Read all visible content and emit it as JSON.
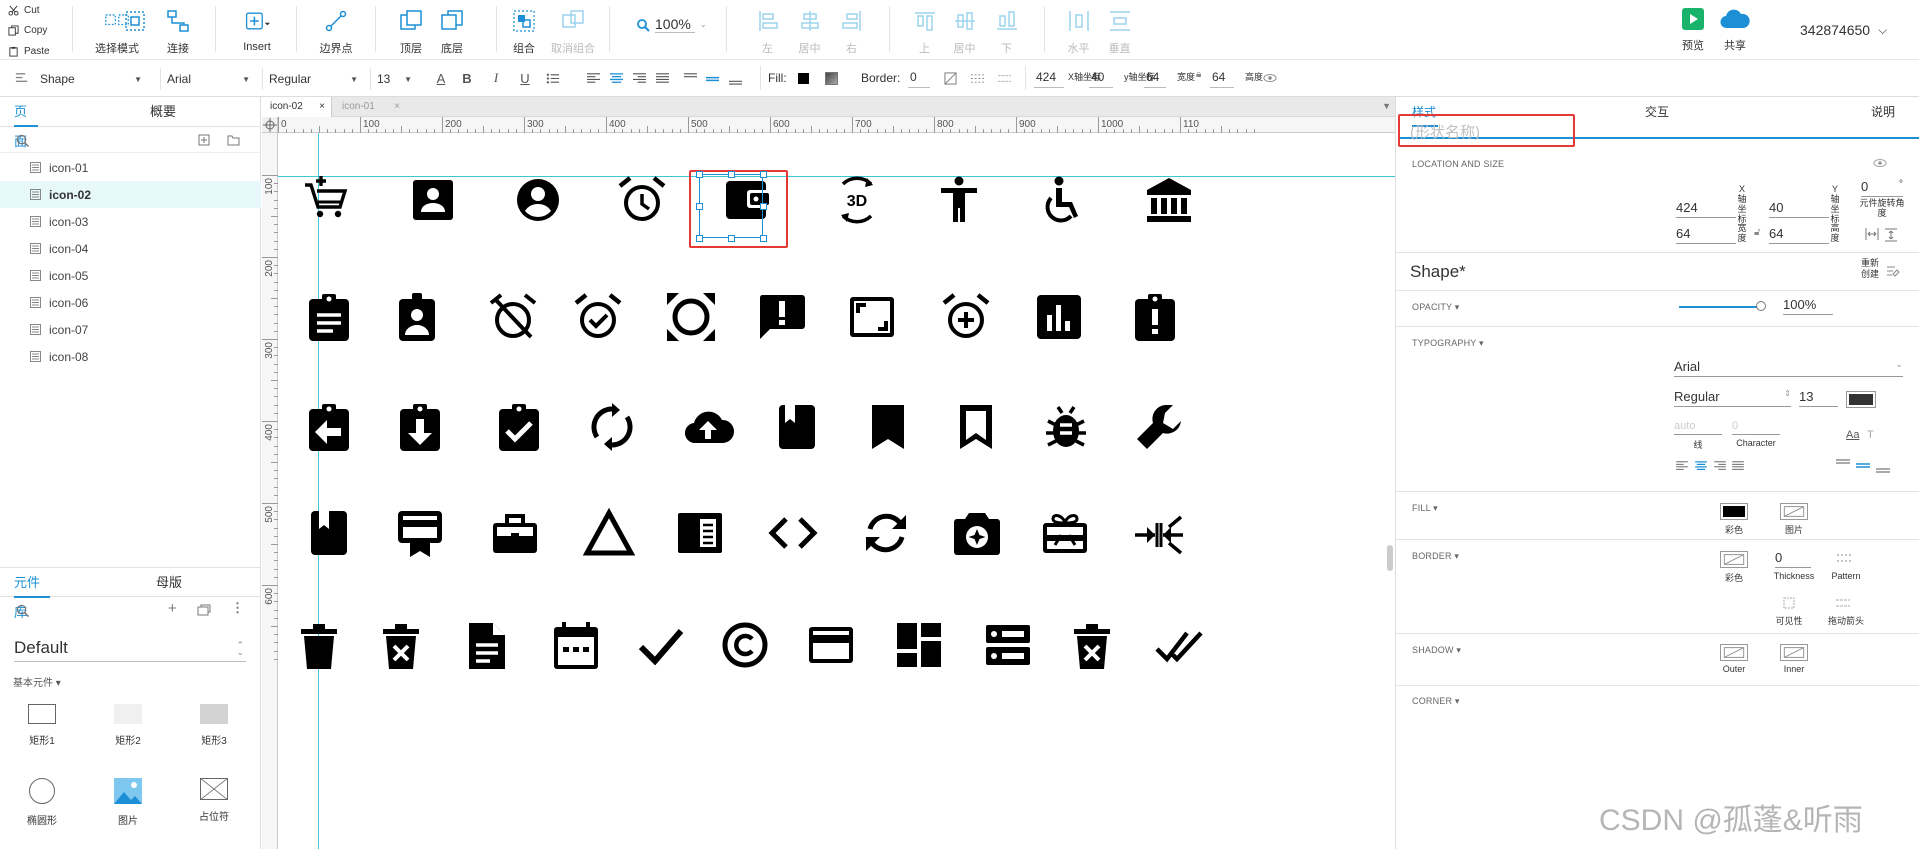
{
  "clipboard": {
    "cut": "Cut",
    "copy": "Copy",
    "paste": "Paste"
  },
  "toolbar": {
    "select_mode": "选择模式",
    "connect": "连接",
    "insert": "Insert",
    "endpoint": "边界点",
    "top_layer": "顶层",
    "bottom_layer": "底层",
    "group": "组合",
    "ungroup": "取消组合",
    "zoom": "100%",
    "align_left": "左",
    "align_center": "居中",
    "align_right": "右",
    "align_top": "上",
    "align_middle": "居中",
    "align_bottom": "下",
    "distribute_h": "水平",
    "distribute_v": "垂直",
    "preview": "预览",
    "share": "共享",
    "user": "342874650"
  },
  "format_bar": {
    "shape_type": "Shape",
    "font": "Arial",
    "weight": "Regular",
    "size": "13",
    "fill_label": "Fill:",
    "border_label": "Border:",
    "border_value": "0",
    "x": "424",
    "x_label": "X轴坐标",
    "y": "40",
    "y_label": "y轴坐标",
    "w": "64",
    "w_label": "宽度",
    "h": "64",
    "h_label": "高度"
  },
  "left_panel": {
    "tabs": [
      "页面",
      "概要"
    ],
    "pages": [
      "icon-01",
      "icon-02",
      "icon-03",
      "icon-04",
      "icon-05",
      "icon-06",
      "icon-07",
      "icon-08"
    ],
    "active_page": "icon-02",
    "lib_tabs": [
      "元件库",
      "母版"
    ],
    "library": "Default",
    "group_title": "基本元件 ▾",
    "components": [
      "矩形1",
      "矩形2",
      "矩形3",
      "椭圆形",
      "图片",
      "占位符"
    ]
  },
  "canvas": {
    "doc_tabs": [
      "icon-02",
      "icon-01"
    ],
    "h_ticks": [
      "0",
      "100",
      "200",
      "300",
      "400",
      "500",
      "600",
      "700",
      "800",
      "900",
      "1000",
      "110"
    ],
    "v_ticks": [
      "100",
      "200",
      "300",
      "400",
      "500",
      "600"
    ],
    "icons": [
      [
        "cart-plus",
        "contact-card",
        "account-circle",
        "alarm-clock",
        "wallet",
        "3d-rotation",
        "accessibility",
        "wheelchair",
        "bank"
      ],
      [
        "clipboard-list",
        "badge-person",
        "alarm-off",
        "alarm-check",
        "crop-free",
        "feedback",
        "aspect-ratio",
        "alarm-add",
        "bar-chart",
        "clipboard-alert"
      ],
      [
        "clipboard-back",
        "clipboard-down",
        "clipboard-check",
        "autorenew",
        "cloud-upload",
        "book-closed",
        "bookmark",
        "bookmark-outline",
        "bug",
        "wrench"
      ],
      [
        "book-bookmark",
        "card-membership",
        "briefcase",
        "triangle-outline",
        "article-block",
        "code",
        "sync",
        "camera-enhance",
        "gift-card",
        "compress-arrows"
      ],
      [
        "trash",
        "trash-x",
        "document",
        "calendar",
        "check",
        "copyright",
        "credit-card",
        "dashboard",
        "dns",
        "trash-x-2",
        "double-check"
      ]
    ]
  },
  "right_panel": {
    "tabs": [
      "样式",
      "交互",
      "说明"
    ],
    "name_placeholder": "(形状名称)",
    "location_title": "LOCATION AND SIZE",
    "x": "424",
    "x_label": "X轴坐标",
    "y": "40",
    "y_label": "Y轴坐标",
    "w": "64",
    "w_label": "宽度",
    "h": "64",
    "h_label": "高度",
    "rotation": "0",
    "rotation_unit": "°",
    "rotation_label": "元件旋转角度",
    "shape_name": "Shape*",
    "refresh": "重新创建",
    "opacity_title": "OPACITY ▾",
    "opacity": "100%",
    "typography_title": "TYPOGRAPHY ▾",
    "font": "Arial",
    "weight": "Regular",
    "size": "13",
    "line_placeholder": "auto",
    "line_label": "线",
    "char_placeholder": "0",
    "char_label": "Character",
    "fill_title": "FILL ▾",
    "fill_color": "彩色",
    "fill_image": "图片",
    "border_title": "BORDER ▾",
    "border_color": "彩色",
    "border_thickness": "0",
    "thickness_label": "Thickness",
    "pattern_label": "Pattern",
    "visibility": "可见性",
    "arrow": "拖动箭头",
    "shadow_title": "SHADOW ▾",
    "shadow_outer": "Outer",
    "shadow_inner": "Inner",
    "corner_title": "CORNER ▾",
    "watermark": "CSDN @孤蓬&听雨"
  },
  "colors": {
    "accent": "#1c8fd6",
    "selection": "#e53935",
    "guide": "#3cc7d8"
  }
}
